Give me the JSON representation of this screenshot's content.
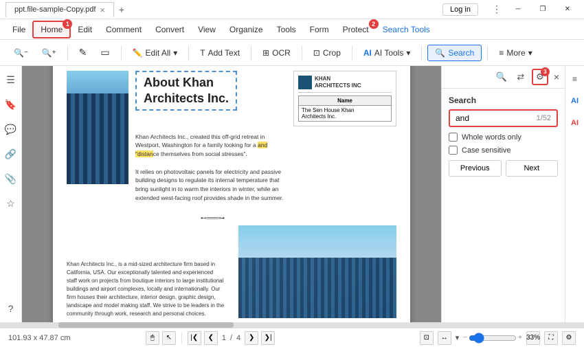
{
  "titlebar": {
    "tab_title": "ppt.file-sample-Copy.pdf",
    "close_tab": "×",
    "new_tab": "+",
    "login_btn": "Log in",
    "win_minimize": "─",
    "win_restore": "❐",
    "win_close": "✕",
    "more_icon": "⋮"
  },
  "menubar": {
    "items": [
      "File",
      "Home",
      "Edit",
      "Comment",
      "Convert",
      "View",
      "Organize",
      "Tools",
      "Form",
      "Protect",
      "Search Tools"
    ],
    "active": "Home",
    "home_badge": "1",
    "protect_badge": "2"
  },
  "toolbar": {
    "edit_all": "Edit All",
    "add_text": "Add Text",
    "ocr": "OCR",
    "crop": "Crop",
    "ai_tools": "AI Tools",
    "search": "Search",
    "more": "More",
    "dropdown_arrow": "▾",
    "undo_icon": "↩",
    "redo_icon": "↪",
    "zoom_in": "+",
    "zoom_out": "−",
    "highlight_icon": "✎",
    "rect_icon": "▭"
  },
  "search_panel": {
    "title": "Search",
    "input_value": "and",
    "count": "1/52",
    "whole_words_label": "Whole words only",
    "case_sensitive_label": "Case sensitive",
    "prev_btn": "Previous",
    "next_btn": "Next",
    "close": "×",
    "badge": "3"
  },
  "pdf_content": {
    "title": "About Khan\nArchitects Inc.",
    "logo_name": "KHAN\nARCHITECTS INC",
    "table_header_name": "Name",
    "table_cell": "The Sen House Khan\nArchitects Inc.",
    "para1": "Khan Architects Inc., created this off-grid retreat in Westport, Washington for a family looking for a",
    "highlight_text": "and \"distance\"",
    "para1b": "themselves from social stresses\".",
    "para2": "It relies on photovoltaic panels for electricity and passive building designs to regulate its internal te...",
    "para2b": "that bring sunlight in to warm the interiors in winter, while an extended west-facing roof provides sh...",
    "para2c": "in the summer.",
    "para3_title": "Khan Architects Inc., is a mid-sized architecture",
    "para3": "firm based in California, USA. Our exceptionally talented and experienced staff work on projects from boutique interiors to large institutional buildings and airport complexes, locally and internationally. Our firm houses their architecture, interior design, graphic design, landscape and model making staff. We strive to be leaders in the community through work, research and personal choices."
  },
  "statusbar": {
    "dimensions": "101.93 x 47.87 cm",
    "page_current": "1",
    "page_total": "4",
    "zoom": "33%",
    "scroll_left": "❮",
    "scroll_right": "❯",
    "prev_page": "❮",
    "next_page": "❯",
    "first_page": "|❮",
    "last_page": "❯|"
  },
  "left_sidebar": {
    "icons": [
      "☰",
      "🔖",
      "💬",
      "🔗",
      "📎",
      "☆"
    ],
    "bottom_icon": "?"
  },
  "right_sidebar": {
    "icons": [
      "≡",
      "🤖",
      "🤖"
    ]
  }
}
